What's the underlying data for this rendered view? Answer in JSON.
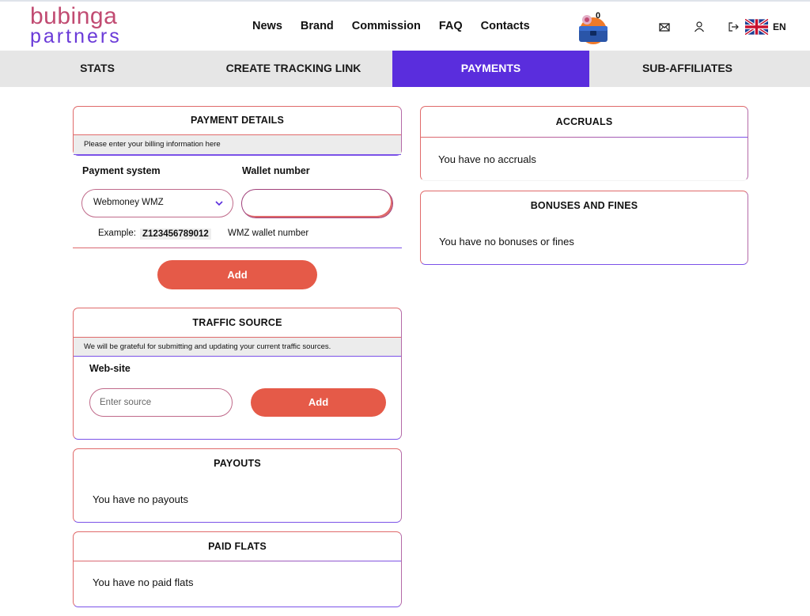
{
  "brand": {
    "line1": "bubinga",
    "line2": "partners"
  },
  "nav": [
    "News",
    "Brand",
    "Commission",
    "FAQ",
    "Contacts"
  ],
  "header": {
    "badge_count": "0",
    "language": "EN"
  },
  "tabs": [
    {
      "label": "STATS"
    },
    {
      "label": "CREATE TRACKING LINK"
    },
    {
      "label": "PAYMENTS",
      "active": true
    },
    {
      "label": "SUB-AFFILIATES"
    }
  ],
  "payment_details": {
    "title": "PAYMENT DETAILS",
    "hint": "Please enter your billing information here",
    "payment_system_label": "Payment system",
    "wallet_label": "Wallet number",
    "payment_system_value": "Webmoney WMZ",
    "wallet_value": "",
    "example_label": "Example:",
    "example_value": "Z123456789012",
    "example_note": "WMZ wallet number",
    "add_label": "Add"
  },
  "traffic_source": {
    "title": "TRAFFIC SOURCE",
    "hint": "We will be grateful for submitting and updating your current traffic sources.",
    "website_label": "Web-site",
    "source_placeholder": "Enter source",
    "add_label": "Add"
  },
  "payouts": {
    "title": "PAYOUTS",
    "empty": "You have no payouts"
  },
  "paid_flats": {
    "title": "PAID FLATS",
    "empty": "You have no paid flats"
  },
  "accruals": {
    "title": "ACCRUALS",
    "empty": "You have no accruals"
  },
  "bonuses": {
    "title": "BONUSES AND FINES",
    "empty": "You have no bonuses or fines"
  },
  "colors": {
    "accent": "#5a2ddd",
    "button": "#e55a48",
    "logo_top": "#c14b72",
    "logo_bottom": "#6a3ad8"
  }
}
